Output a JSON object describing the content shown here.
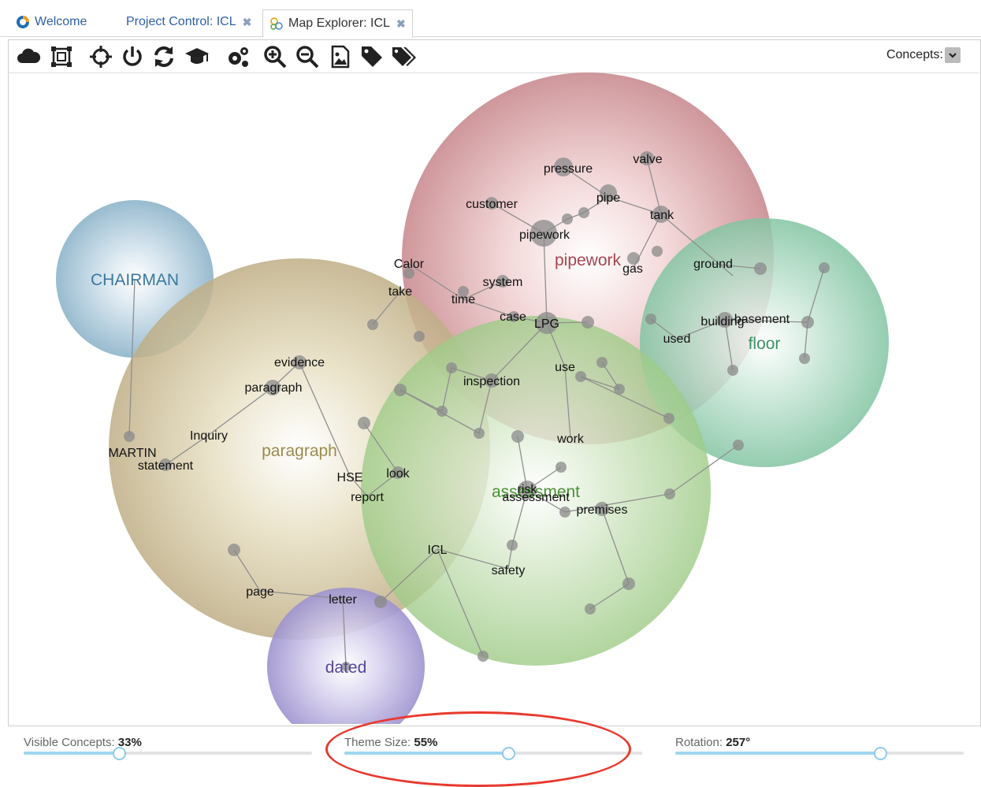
{
  "tabs": [
    {
      "label": "Welcome"
    },
    {
      "label": "Project Control: ICL"
    },
    {
      "label": "Map Explorer: ICL"
    }
  ],
  "toolbar": {
    "icons": [
      "cloud-icon",
      "fit-to-window-icon",
      "center-icon",
      "power-icon",
      "refresh-icon",
      "learn-icon",
      "settings-icon",
      "zoom-in-icon",
      "zoom-out-icon",
      "export-image-icon",
      "tag-icon",
      "tags-icon"
    ],
    "concepts_label": "Concepts:"
  },
  "themes": [
    {
      "label": "pipework",
      "color": "#b24a55"
    },
    {
      "label": "CHAIRMAN",
      "color": "#3c7ea8"
    },
    {
      "label": "paragraph",
      "color": "#a1914f"
    },
    {
      "label": "floor",
      "color": "#3e9a6a"
    },
    {
      "label": "assessment",
      "color": "#4f9a3a"
    },
    {
      "label": "dated",
      "color": "#5a4aa0"
    }
  ],
  "concepts": [
    "pressure",
    "valve",
    "customer",
    "pipe",
    "tank",
    "pipework",
    "gas",
    "ground",
    "Calor",
    "system",
    "take",
    "time",
    "case",
    "LPG",
    "basement",
    "building",
    "used",
    "evidence",
    "use",
    "paragraph",
    "inspection",
    "Inquiry",
    "work",
    "MARTIN",
    "statement",
    "HSE",
    "look",
    "report",
    "risk",
    "assessment",
    "premises",
    "ICL",
    "safety",
    "page",
    "letter"
  ],
  "sliders": [
    {
      "label": "Visible Concepts:",
      "value": "33%",
      "level": 0.33
    },
    {
      "label": "Theme Size:",
      "value": "55%",
      "level": 0.55
    },
    {
      "label": "Rotation:",
      "value": "257°",
      "level": 0.71
    }
  ]
}
